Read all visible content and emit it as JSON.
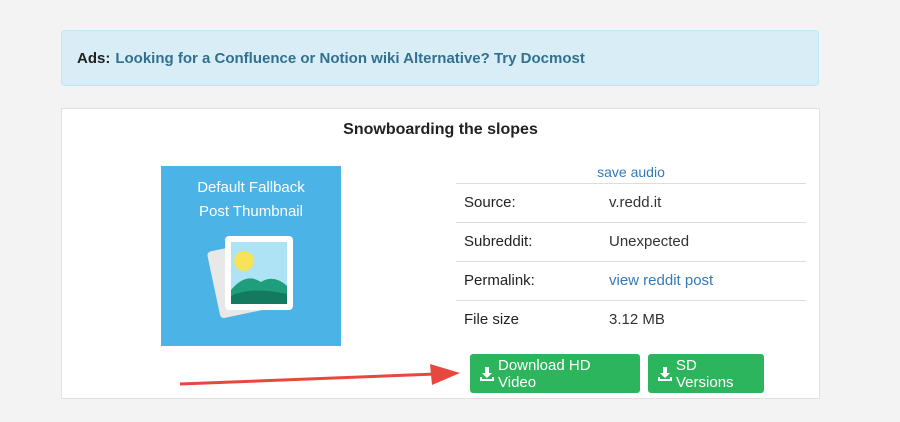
{
  "ads": {
    "label": "Ads:",
    "link_text": "Looking for a Confluence or Notion wiki Alternative? Try Docmost"
  },
  "post": {
    "title": "Snowboarding the slopes",
    "thumbnail_caption_line1": "Default Fallback",
    "thumbnail_caption_line2": "Post Thumbnail",
    "save_audio": "save audio"
  },
  "details": [
    {
      "key": "Source:",
      "value": "v.redd.it"
    },
    {
      "key": "Subreddit:",
      "value": "Unexpected"
    },
    {
      "key": "Permalink:",
      "value": "view reddit post"
    },
    {
      "key": "File size",
      "value": "3.12 MB"
    }
  ],
  "buttons": {
    "hd": "Download HD Video",
    "sd": "SD Versions"
  },
  "colors": {
    "accent_green": "#2db55d",
    "link_blue": "#337ab7",
    "alert_bg": "#d9edf7",
    "arrow_red": "#e8473f"
  },
  "icons": {
    "download": "download-icon",
    "placeholder": "image-placeholder-icon"
  }
}
